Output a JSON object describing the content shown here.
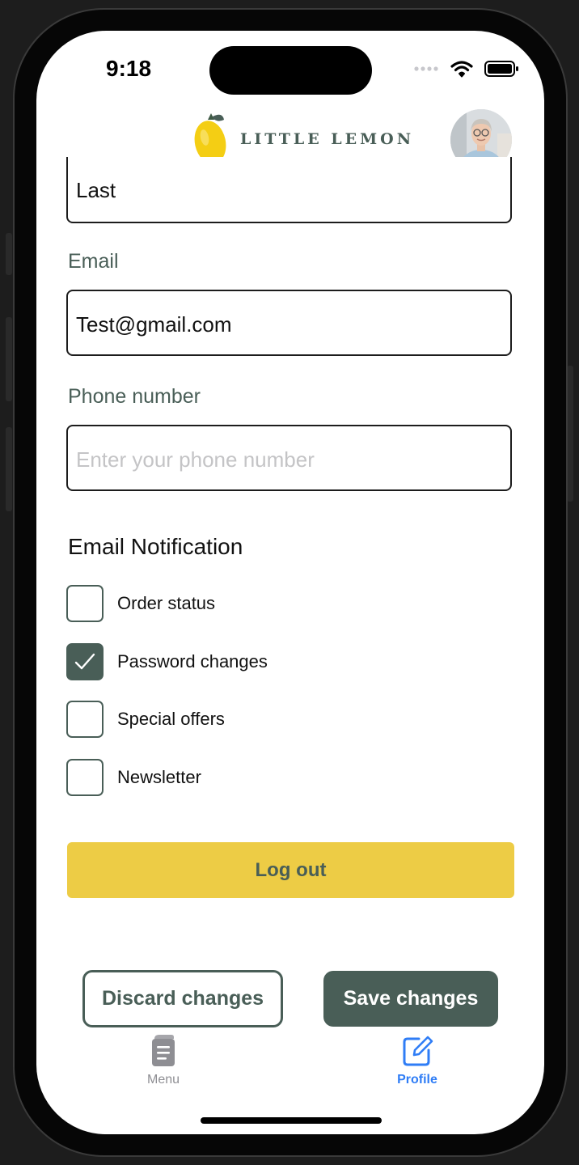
{
  "status_bar": {
    "time": "9:18"
  },
  "header": {
    "logo_text": "LITTLE LEMON"
  },
  "form": {
    "last_name": {
      "value": "Last"
    },
    "email": {
      "label": "Email",
      "value": "Test@gmail.com"
    },
    "phone": {
      "label": "Phone number",
      "value": "",
      "placeholder": "Enter your phone number"
    }
  },
  "notifications": {
    "title": "Email Notification",
    "items": [
      {
        "label": "Order status",
        "checked": false
      },
      {
        "label": "Password changes",
        "checked": true
      },
      {
        "label": "Special offers",
        "checked": false
      },
      {
        "label": "Newsletter",
        "checked": false
      }
    ]
  },
  "actions": {
    "logout": "Log out",
    "discard": "Discard changes",
    "save": "Save changes"
  },
  "tabbar": {
    "items": [
      {
        "label": "Menu",
        "icon": "menu-book-icon",
        "active": false
      },
      {
        "label": "Profile",
        "icon": "edit-square-icon",
        "active": true
      }
    ]
  },
  "colors": {
    "primary": "#495e57",
    "accent": "#edcc45",
    "tab_active": "#2f7df6",
    "tab_inactive": "#8e8e93"
  }
}
